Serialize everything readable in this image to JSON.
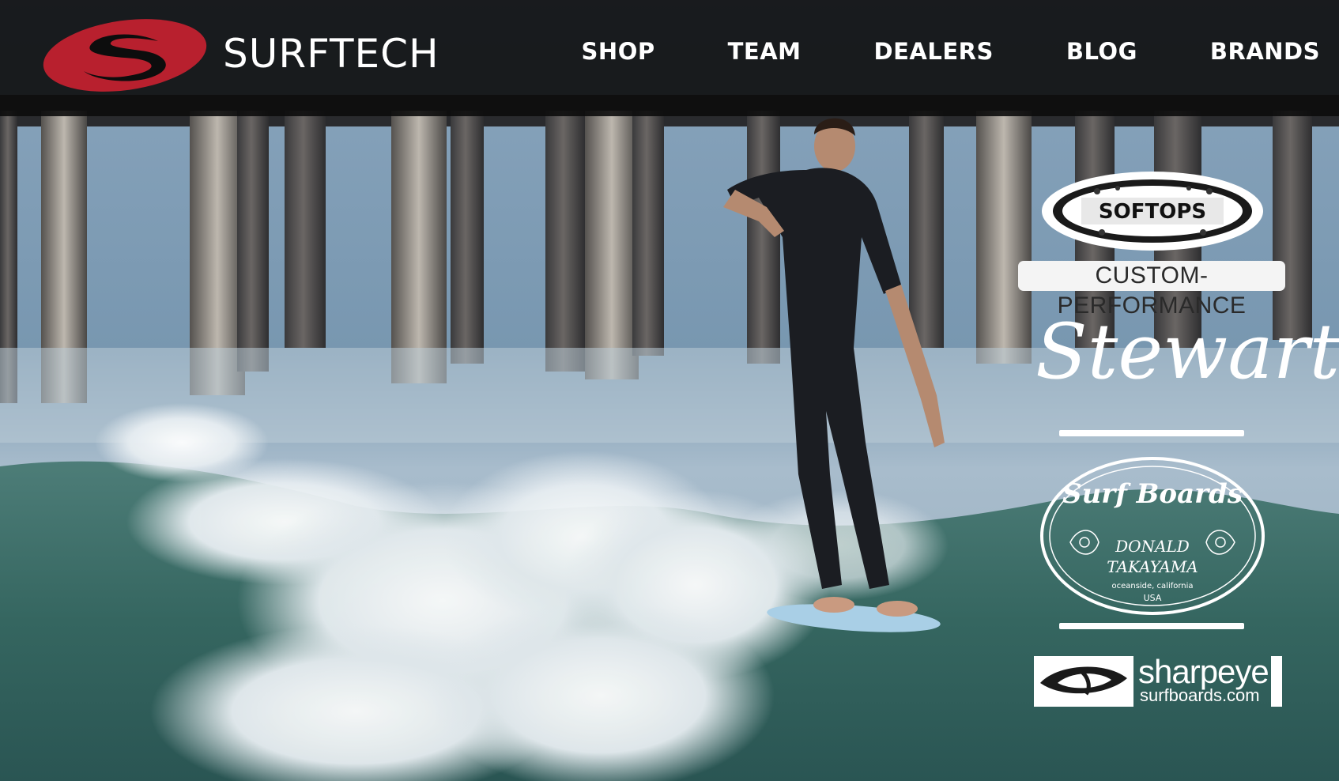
{
  "header": {
    "brand": "SURFTECH",
    "nav": [
      "SHOP",
      "TEAM",
      "DEALERS",
      "BLOG",
      "BRANDS"
    ]
  },
  "brands": {
    "softops": "SOFTOPS",
    "custom_performance": "CUSTOM-PERFORMANCE",
    "stewart": "Stewart",
    "takayama": {
      "title": "Surf Boards",
      "line1": "DONALD",
      "line2": "TAKAYAMA",
      "location": "oceanside, california",
      "country": "USA"
    },
    "sharpeye": {
      "name": "sharpeye",
      "domain": "surfboards.com"
    }
  },
  "colors": {
    "header_bg": "#0c0c0c",
    "logo_red": "#b8202e",
    "nav_text": "#ffffff",
    "ocean": "#3f6f6c",
    "sky_water": "#7f9cb4"
  }
}
